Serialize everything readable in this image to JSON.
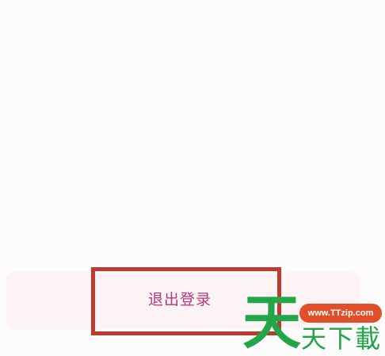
{
  "account_settings": {
    "logout_label": "退出登录"
  },
  "watermark": {
    "big_glyph": "天",
    "url": "www.TTzip.com",
    "text": "天下載"
  },
  "colors": {
    "background": "#fdfbfb",
    "button_background": "#fcf4f4",
    "logout_text": "#b8367b",
    "highlight_border": "#be3b2f",
    "watermark_green": "#21a64a",
    "watermark_orange": "#e04e2a"
  }
}
